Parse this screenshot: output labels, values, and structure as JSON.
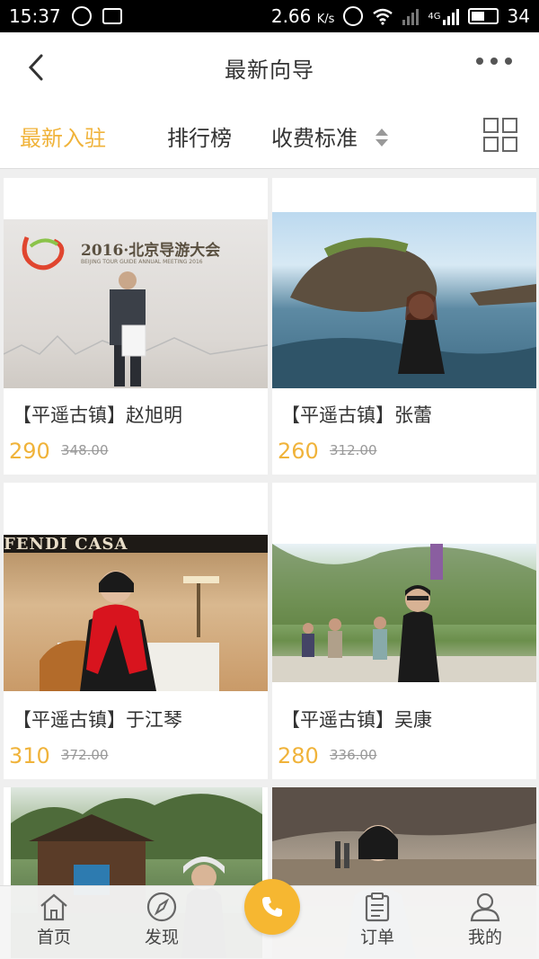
{
  "status_bar": {
    "time": "15:37",
    "speed": "2.66",
    "speed_unit": "K/s",
    "network": "4G",
    "battery": "34",
    "icons": [
      "qq-icon",
      "image-icon",
      "alarm-icon",
      "wifi-icon",
      "signal-icon",
      "battery-icon"
    ]
  },
  "header": {
    "title": "最新向导",
    "back_icon": "back-arrow-icon",
    "more_icon": "more-dots-icon"
  },
  "tabs": {
    "items": [
      {
        "label": "最新入驻",
        "active": true
      },
      {
        "label": "排行榜",
        "active": false
      },
      {
        "label": "收费标准",
        "active": false
      }
    ],
    "sort_icon": "sort-updown-icon",
    "view_icon": "grid-view-icon",
    "accent_color": "#f0b33a"
  },
  "guides": [
    {
      "name": "【平遥古镇】赵旭明",
      "price": "290",
      "original_price": "348.00",
      "banner": "2016·北京导游大会",
      "banner_sub": "BEIJING TOUR GUIDE ANNUAL MEETING 2016"
    },
    {
      "name": "【平遥古镇】张蕾",
      "price": "260",
      "original_price": "312.00"
    },
    {
      "name": "【平遥古镇】于江琴",
      "price": "310",
      "original_price": "372.00",
      "banner": "FENDI CASA"
    },
    {
      "name": "【平遥古镇】吴康",
      "price": "280",
      "original_price": "336.00"
    },
    {},
    {}
  ],
  "tabbar": {
    "items": [
      {
        "label": "首页",
        "icon": "home-icon"
      },
      {
        "label": "发现",
        "icon": "compass-icon"
      },
      {
        "label": "订单",
        "icon": "clipboard-icon"
      },
      {
        "label": "我的",
        "icon": "user-icon"
      }
    ],
    "center_icon": "phone-icon",
    "center_color": "#f6b731"
  }
}
